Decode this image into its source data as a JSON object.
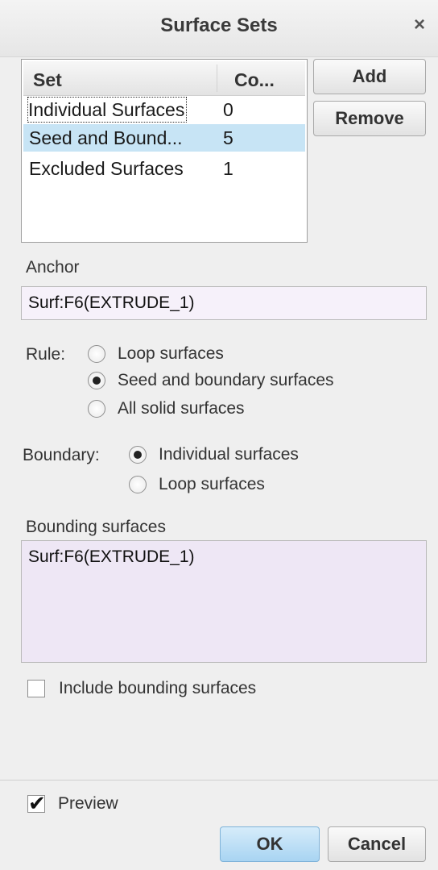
{
  "window": {
    "title": "Surface Sets",
    "close_icon": "×"
  },
  "sets": {
    "columns": [
      "Set",
      "Co..."
    ],
    "rows": [
      {
        "name": "Individual Surfaces",
        "count": "0",
        "selected": false
      },
      {
        "name": "Seed and Bound...",
        "count": "5",
        "selected": true
      },
      {
        "name": "Excluded Surfaces",
        "count": "1",
        "selected": false
      }
    ]
  },
  "buttons": {
    "add": "Add",
    "remove": "Remove",
    "ok": "OK",
    "cancel": "Cancel"
  },
  "anchor": {
    "label": "Anchor",
    "value": "Surf:F6(EXTRUDE_1)"
  },
  "rule": {
    "label": "Rule:",
    "options": [
      "Loop surfaces",
      "Seed and boundary surfaces",
      "All solid surfaces"
    ],
    "selected": "Seed and boundary surfaces"
  },
  "boundary": {
    "label": "Boundary:",
    "options": [
      "Individual surfaces",
      "Loop surfaces"
    ],
    "selected": "Individual surfaces"
  },
  "bounding": {
    "label": "Bounding surfaces",
    "items": [
      "Surf:F6(EXTRUDE_1)"
    ]
  },
  "include_bounding": {
    "label": "Include bounding surfaces",
    "checked": false
  },
  "preview": {
    "label": "Preview",
    "checked": true
  },
  "colors": {
    "selection": "#c7e4f5",
    "field_bg": "#f6f1fa",
    "bounding_bg": "#eee7f5",
    "ok_button": "#a8d4f2"
  }
}
